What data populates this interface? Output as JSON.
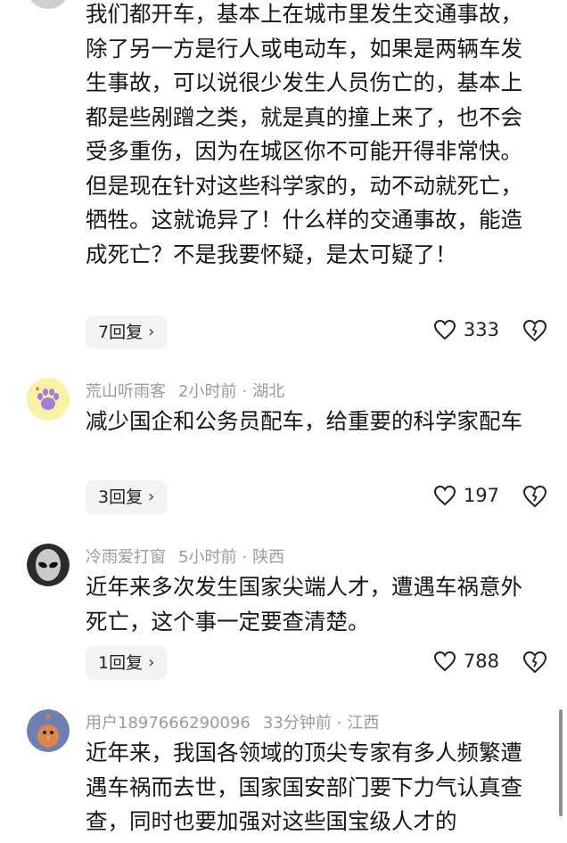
{
  "comments": [
    {
      "text": "我们都开车，基本上在城市里发生交通事故，除了另一方是行人或电动车，如果是两辆车发生事故，可以说很少发生人员伤亡的，基本上都是些剐蹭之类，就是真的撞上来了，也不会受多重伤，因为在城区你不可能开得非常快。但是现在针对这些科学家的，动不动就死亡，牺牲。这就诡异了！什么样的交通事故，能造成死亡？不是我要怀疑，是太可疑了！",
      "replies": "7回复",
      "likes": "333"
    },
    {
      "username": "荒山听雨客",
      "time": "2小时前",
      "location": "湖北",
      "text": "减少国企和公务员配车，给重要的科学家配车",
      "replies": "3回复",
      "likes": "197"
    },
    {
      "username": "冷雨爱打窗",
      "time": "5小时前",
      "location": "陕西",
      "text": "近年来多次发生国家尖端人才，遭遇车祸意外死亡，这个事一定要查清楚。",
      "replies": "1回复",
      "likes": "788"
    },
    {
      "username": "用户1897666290096",
      "time": "33分钟前",
      "location": "江西",
      "text": "近年来，我国各领域的顶尖专家有多人频繁遭遇车祸而去世，国家国安部门要下力气认真查查，同时也要加强对这些国宝级人才的"
    }
  ],
  "ui": {
    "separator": "·",
    "chevron": "›"
  }
}
